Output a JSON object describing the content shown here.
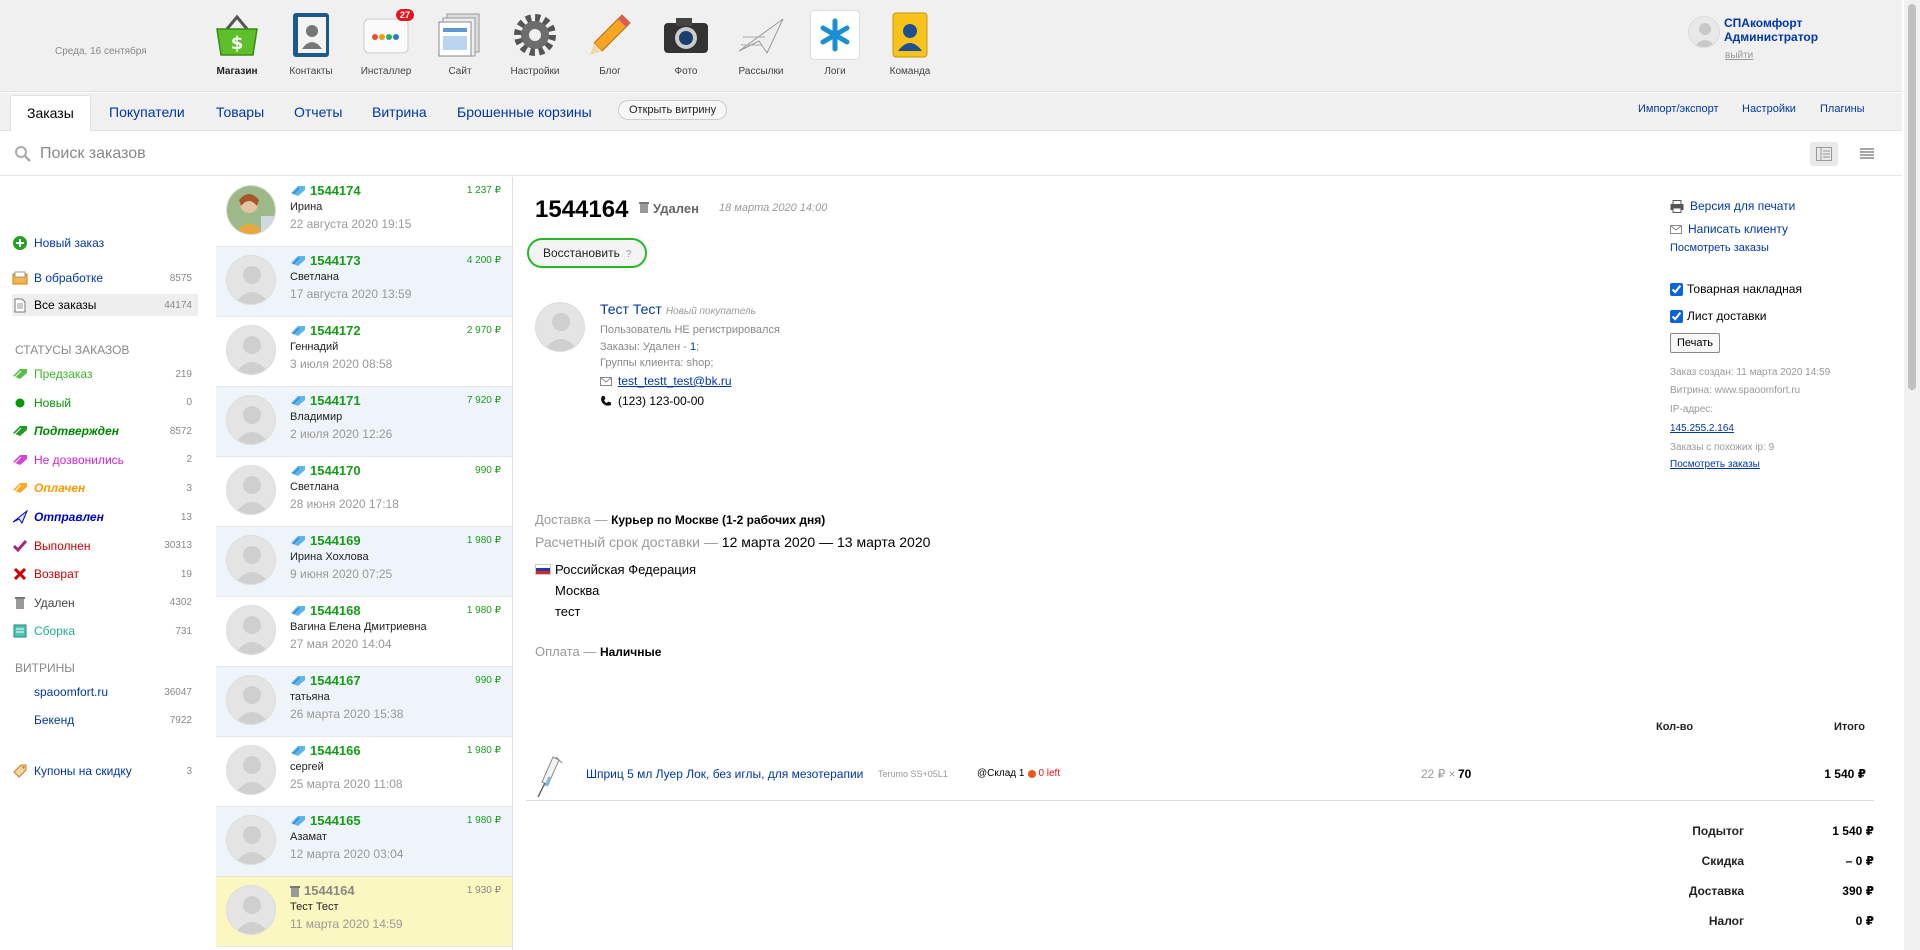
{
  "header": {
    "date": "Среда, 16 сентября",
    "apps": [
      {
        "label": "Магазин",
        "icon": "basket-icon"
      },
      {
        "label": "Контакты",
        "icon": "contacts-icon"
      },
      {
        "label": "Инсталлер",
        "icon": "installer-icon",
        "badge": "27"
      },
      {
        "label": "Сайт",
        "icon": "site-icon"
      },
      {
        "label": "Настройки",
        "icon": "gear-icon"
      },
      {
        "label": "Блог",
        "icon": "pencil-icon"
      },
      {
        "label": "Фото",
        "icon": "camera-icon"
      },
      {
        "label": "Рассылки",
        "icon": "mailer-icon"
      },
      {
        "label": "Логи",
        "icon": "logs-icon"
      },
      {
        "label": "Команда",
        "icon": "team-icon"
      }
    ],
    "user": {
      "name": "СПАкомфорт Администратор",
      "logout": "выйти"
    }
  },
  "tabs": {
    "items": [
      "Заказы",
      "Покупатели",
      "Товары",
      "Отчеты",
      "Витрина",
      "Брошенные корзины"
    ],
    "open_storefront": "Открыть витрину",
    "right": [
      "Импорт/экспорт",
      "Настройки",
      "Плагины"
    ]
  },
  "search": {
    "placeholder": "Поиск заказов"
  },
  "sidebar": {
    "new_order": "Новый заказ",
    "in_process": {
      "label": "В обработке",
      "count": "8575"
    },
    "all_orders": {
      "label": "Все заказы",
      "count": "44174"
    },
    "statuses_heading": "СТАТУСЫ ЗАКАЗОВ",
    "statuses": [
      {
        "label": "Предзаказ",
        "count": "219",
        "color": "#38b523"
      },
      {
        "label": "Новый",
        "count": "0",
        "color": "#009900"
      },
      {
        "label": "Подтвержден",
        "count": "8572",
        "color": "#008800"
      },
      {
        "label": "Не дозвонились",
        "count": "2",
        "color": "#cc22cc"
      },
      {
        "label": "Оплачен",
        "count": "3",
        "color": "#ff9900"
      },
      {
        "label": "Отправлен",
        "count": "13",
        "color": "#0000cc"
      },
      {
        "label": "Выполнен",
        "count": "30313",
        "color": "#cc0000"
      },
      {
        "label": "Возврат",
        "count": "19",
        "color": "#cc0000"
      },
      {
        "label": "Удален",
        "count": "4302",
        "color": "#444444"
      },
      {
        "label": "Сборка",
        "count": "731",
        "color": "#22aa99"
      }
    ],
    "storefronts_heading": "ВИТРИНЫ",
    "storefronts": [
      {
        "label": "spaoomfort.ru",
        "count": "36047"
      },
      {
        "label": "Бекенд",
        "count": "7922"
      }
    ],
    "coupons": {
      "label": "Купоны на скидку",
      "count": "3"
    }
  },
  "orders": [
    {
      "num": "1544174",
      "sum": "1 237 ₽",
      "customer": "Ирина",
      "date": "22 августа 2020 19:15"
    },
    {
      "num": "1544173",
      "sum": "4 200 ₽",
      "customer": "Светлана",
      "date": "17 августа 2020 13:59"
    },
    {
      "num": "1544172",
      "sum": "2 970 ₽",
      "customer": "Геннадий",
      "date": "3 июля 2020 08:58"
    },
    {
      "num": "1544171",
      "sum": "7 920 ₽",
      "customer": "Владимир",
      "date": "2 июля 2020 12:26"
    },
    {
      "num": "1544170",
      "sum": "990 ₽",
      "customer": "Светлана",
      "date": "28 июня 2020 17:18"
    },
    {
      "num": "1544169",
      "sum": "1 980 ₽",
      "customer": "Ирина Хохлова",
      "date": "9 июня 2020 07:25"
    },
    {
      "num": "1544168",
      "sum": "1 980 ₽",
      "customer": "Вагина Елена Дмитриевна",
      "date": "27 мая 2020 14:04"
    },
    {
      "num": "1544167",
      "sum": "990 ₽",
      "customer": "татьяна",
      "date": "26 марта 2020 15:38"
    },
    {
      "num": "1544166",
      "sum": "1 980 ₽",
      "customer": "сергей",
      "date": "25 марта 2020 11:08"
    },
    {
      "num": "1544165",
      "sum": "1 980 ₽",
      "customer": "Азамат",
      "date": "12 марта 2020 03:04"
    },
    {
      "num": "1544164",
      "sum": "1 930 ₽",
      "customer": "Тест Тест",
      "date": "11 марта 2020 14:59"
    }
  ],
  "order": {
    "number": "1544164",
    "status": "Удален",
    "status_date": "18 марта 2020 14:00",
    "restore": "Восстановить",
    "restore_hint": "?",
    "customer": {
      "name": "Тест Тест",
      "new_label": "Новый покупатель",
      "not_registered": "Пользователь НЕ регистрировался",
      "orders_prefix": "Заказы: Удален - ",
      "orders_count": "1",
      "orders_suffix": ";",
      "groups": "Группы клиента: shop;",
      "email": "test_testt_test@bk.ru",
      "phone": "(123) 123-00-00"
    },
    "delivery": {
      "label": "Доставка —",
      "method": "Курьер по Москве (1-2 рабочих дня)",
      "term_label": "Расчетный срок доставки —",
      "term": "12 марта 2020 — 13 марта 2020",
      "country": "Российская Федерация",
      "city": "Москва",
      "address": "тест"
    },
    "payment": {
      "label": "Оплата —",
      "method": "Наличные"
    },
    "right": {
      "print_version": "Версия для печати",
      "write_client": "Написать клиенту",
      "view_orders": "Посмотреть заказы",
      "check_invoice": "Товарная накладная",
      "check_delivery": "Лист доставки",
      "print": "Печать",
      "created": "Заказ создан: 11 марта 2020 14:59",
      "storefront": "Витрина: www.spaoomfort.ru",
      "ip_label": "IP-адрес:",
      "ip": "145.255.2.164",
      "similar_ip": "Заказы с похожих ip: 9",
      "view_orders2": "Посмотреть заказы"
    },
    "table": {
      "qty_header": "Кол-во",
      "total_header": "Итого"
    },
    "item": {
      "name": "Шприц 5 мл Луер Лок, без иглы, для мезотерапии",
      "sku": "Terumo SS+05L1",
      "stock": "@Склад 1",
      "stock_left": "0 left",
      "price": "22 ₽ ×",
      "qty": "70",
      "total": "1 540 ₽"
    },
    "totals": [
      {
        "label": "Подытог",
        "value": "1 540 ₽"
      },
      {
        "label": "Скидка",
        "value": "– 0 ₽"
      },
      {
        "label": "Доставка",
        "value": "390 ₽"
      },
      {
        "label": "Налог",
        "value": "0 ₽"
      }
    ]
  }
}
